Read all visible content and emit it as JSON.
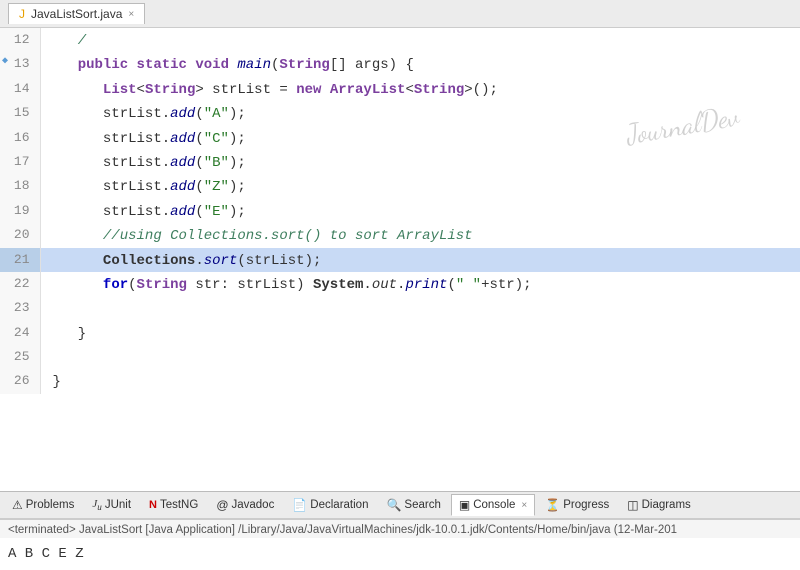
{
  "titlebar": {
    "tab_label": "JavaListSort.java",
    "close_icon": "×"
  },
  "code": {
    "lines": [
      {
        "num": "12",
        "content": "   ·"
      },
      {
        "num": "13",
        "content": "   public static void main(String[] args) {",
        "has_arrow": true
      },
      {
        "num": "14",
        "content": "      List<String> strList = new ArrayList<String>();"
      },
      {
        "num": "15",
        "content": "      strList.add(\"A\");"
      },
      {
        "num": "16",
        "content": "      strList.add(\"C\");"
      },
      {
        "num": "17",
        "content": "      strList.add(\"B\");"
      },
      {
        "num": "18",
        "content": "      strList.add(\"Z\");"
      },
      {
        "num": "19",
        "content": "      strList.add(\"E\");"
      },
      {
        "num": "20",
        "content": "      //using Collections.sort() to sort ArrayList"
      },
      {
        "num": "21",
        "content": "      Collections.sort(strList);",
        "highlighted": true
      },
      {
        "num": "22",
        "content": "      for(String str: strList) System.out.print(\" \"+str);"
      },
      {
        "num": "23",
        "content": ""
      },
      {
        "num": "24",
        "content": "   }"
      },
      {
        "num": "25",
        "content": ""
      },
      {
        "num": "26",
        "content": "}"
      }
    ]
  },
  "watermark": "JournalDev",
  "bottom_tabs": [
    {
      "id": "problems",
      "label": "Problems",
      "icon": "⚠"
    },
    {
      "id": "junit",
      "label": "JUnit",
      "icon": "Jᵤ"
    },
    {
      "id": "testng",
      "label": "TestNG",
      "icon": "🅝"
    },
    {
      "id": "javadoc",
      "label": "Javadoc",
      "icon": "@"
    },
    {
      "id": "declaration",
      "label": "Declaration",
      "icon": "📋"
    },
    {
      "id": "search",
      "label": "Search",
      "icon": "🔍"
    },
    {
      "id": "console",
      "label": "Console",
      "icon": "▣",
      "active": true
    },
    {
      "id": "progress",
      "label": "Progress",
      "icon": "⏳"
    },
    {
      "id": "diagrams",
      "label": "Diagrams",
      "icon": "◫"
    }
  ],
  "status": {
    "terminated_label": "<terminated> JavaListSort [Java Application] /Library/Java/JavaVirtualMachines/jdk-10.0.1.jdk/Contents/Home/bin/java (12-Mar-201"
  },
  "output": {
    "text": "A  B  C  E  Z"
  }
}
